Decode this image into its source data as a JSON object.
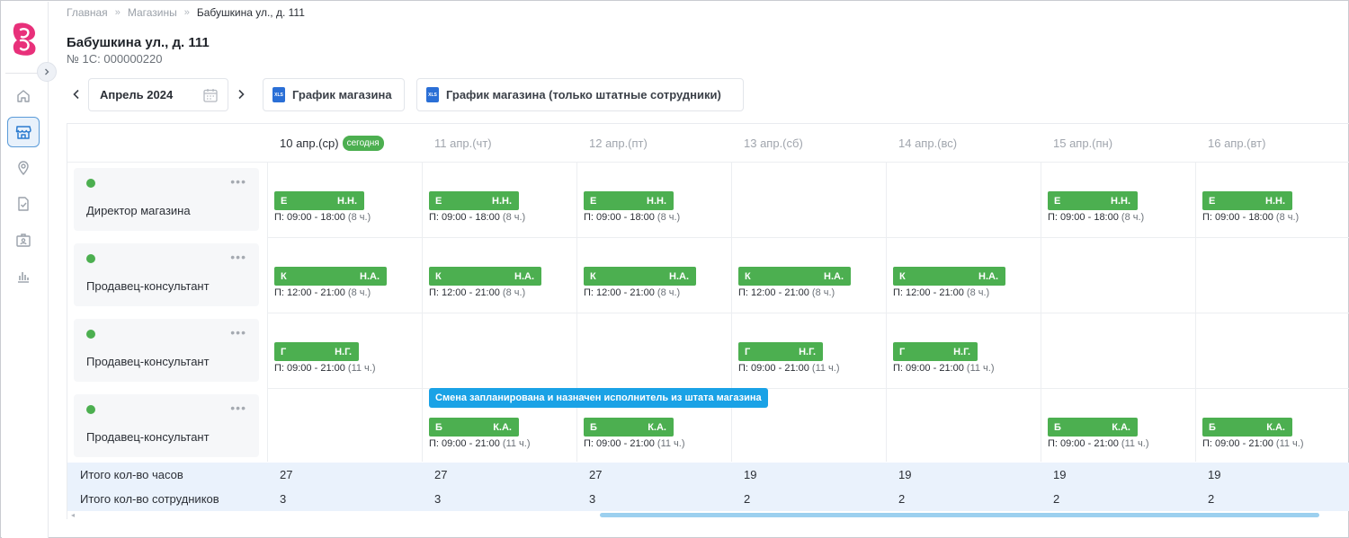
{
  "breadcrumb": {
    "items": [
      "Главная",
      "Магазины",
      "Бабушкина ул., д. 111"
    ],
    "separator": "»"
  },
  "page": {
    "title": "Бабушкина ул., д. 111",
    "subtitle": "№ 1С: 000000220"
  },
  "toolbar": {
    "month": "Апрель 2024",
    "xls_icon_text": "XLS",
    "export_store": "График магазина",
    "export_staff": "График магазина (только штатные сотрудники)"
  },
  "sidebar": {
    "items": [
      "home-icon",
      "store-icon",
      "location-icon",
      "task-check-icon",
      "employee-card-icon",
      "reports-chart-icon"
    ],
    "active": "store-icon",
    "brand_color": "#e8307a"
  },
  "days": [
    {
      "label": "10 апр.(ср)",
      "today": true
    },
    {
      "label": "11 апр.(чт)",
      "today": false
    },
    {
      "label": "12 апр.(пт)",
      "today": false
    },
    {
      "label": "13 апр.(сб)",
      "today": false
    },
    {
      "label": "14 апр.(вс)",
      "today": false
    },
    {
      "label": "15 апр.(пн)",
      "today": false
    },
    {
      "label": "16 апр.(вт)",
      "today": false
    }
  ],
  "today_badge": "сегодня",
  "roles": [
    {
      "name": "Директор магазина",
      "more": "•••"
    },
    {
      "name": "Продавец-консультант",
      "more": "•••"
    },
    {
      "name": "Продавец-консультант",
      "more": "•••"
    },
    {
      "name": "Продавец-консультант",
      "more": "•••"
    }
  ],
  "shifts": {
    "r0": {
      "first": "Е",
      "initials": "Н.Н.",
      "time": "П: 09:00 - 18:00",
      "hours": "(8 ч.)"
    },
    "r1": {
      "first": "К",
      "initials": "Н.А.",
      "time": "П: 12:00 - 21:00",
      "hours": "(8 ч.)"
    },
    "r2": {
      "first": "Г",
      "initials": "Н.Г.",
      "time": "П: 09:00 - 21:00",
      "hours": "(11 ч.)"
    },
    "r3": {
      "first": "Б",
      "initials": "К.А.",
      "time": "П: 09:00 - 21:00",
      "hours": "(11 ч.)"
    }
  },
  "tooltip": "Смена запланирована и назначен исполнитель из штата магазина",
  "totals": {
    "hours_label": "Итого кол-во часов",
    "hours": [
      "27",
      "27",
      "27",
      "19",
      "19",
      "19",
      "19"
    ],
    "staff_label": "Итого кол-во сотрудников",
    "staff": [
      "3",
      "3",
      "3",
      "2",
      "2",
      "2",
      "2"
    ]
  },
  "colors": {
    "shift_green": "#4caf50",
    "tooltip_blue": "#1aa2e6",
    "totals_bg": "#eaf2fc",
    "active_nav": "#5b9bd8"
  }
}
